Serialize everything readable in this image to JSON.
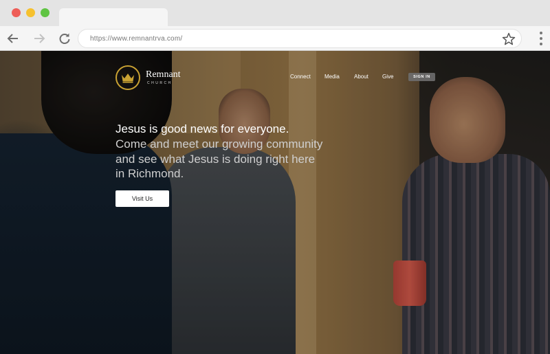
{
  "browser": {
    "url": "https://www.remnantrva.com/",
    "colors": {
      "close": "#ee5d57",
      "minimize": "#f6c12f",
      "zoom": "#5fc443"
    },
    "icons": [
      "back-icon",
      "forward-icon",
      "reload-icon",
      "star-icon",
      "menu-icon"
    ]
  },
  "site": {
    "logo": {
      "name": "Remnant",
      "sub": "CHURCH",
      "icon": "crown-icon",
      "accent": "#c9a233"
    },
    "nav": [
      "Connect",
      "Media",
      "About",
      "Give"
    ],
    "signin": "SIGN IN",
    "hero": {
      "headline": "Jesus is good news for everyone.",
      "sub1": "Come and meet our growing community",
      "sub2": "and see what Jesus is doing right here",
      "sub3": "in Richmond.",
      "cta": "Visit Us"
    }
  }
}
